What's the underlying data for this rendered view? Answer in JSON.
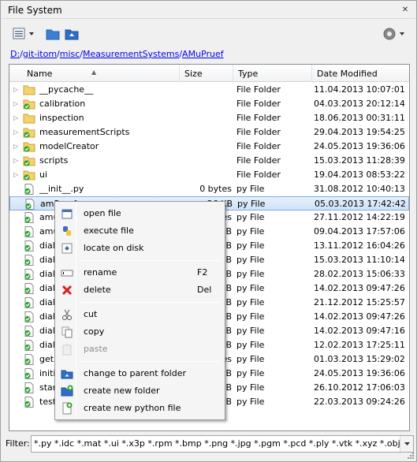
{
  "window": {
    "title": "File System"
  },
  "toolbar": {
    "view_icon": "view-list-icon",
    "folder_icon": "folder-icon",
    "parent_icon": "parent-folder-icon",
    "settings_icon": "gear-icon"
  },
  "path": {
    "segments": [
      "D:",
      "git-itom",
      "misc",
      "MeasurementSystems",
      "AMuPruef"
    ],
    "separator": "/"
  },
  "columns": {
    "name": "Name",
    "size": "Size",
    "type": "Type",
    "date": "Date Modified"
  },
  "files": [
    {
      "name": "__pycache__",
      "size": "",
      "type": "File Folder",
      "date": "11.04.2013 10:07:01",
      "kind": "folder",
      "expandable": true
    },
    {
      "name": "calibration",
      "size": "",
      "type": "File Folder",
      "date": "04.03.2013 20:12:14",
      "kind": "folder-check",
      "expandable": true
    },
    {
      "name": "inspection",
      "size": "",
      "type": "File Folder",
      "date": "18.06.2013 00:31:11",
      "kind": "folder",
      "expandable": true
    },
    {
      "name": "measurementScripts",
      "size": "",
      "type": "File Folder",
      "date": "29.04.2013 19:54:25",
      "kind": "folder-check",
      "expandable": true
    },
    {
      "name": "modelCreator",
      "size": "",
      "type": "File Folder",
      "date": "24.05.2013 19:36:06",
      "kind": "folder-check",
      "expandable": true
    },
    {
      "name": "scripts",
      "size": "",
      "type": "File Folder",
      "date": "15.03.2013 11:28:39",
      "kind": "folder-check",
      "expandable": true
    },
    {
      "name": "ui",
      "size": "",
      "type": "File Folder",
      "date": "19.04.2013 08:53:22",
      "kind": "folder-check",
      "expandable": true
    },
    {
      "name": "__init__.py",
      "size": "0 bytes",
      "type": "py File",
      "date": "31.08.2012 10:40:13",
      "kind": "py",
      "expandable": false
    },
    {
      "name": "amPruef.py",
      "size": "26 KB",
      "type": "py File",
      "date": "05.03.2013 17:42:42",
      "kind": "py",
      "expandable": false,
      "selected": true
    },
    {
      "name": "amu",
      "size": "es",
      "type": "py File",
      "date": "27.11.2012 14:22:19",
      "kind": "py",
      "expandable": false
    },
    {
      "name": "amu",
      "size": "B",
      "type": "py File",
      "date": "09.04.2013 17:57:06",
      "kind": "py",
      "expandable": false
    },
    {
      "name": "dial",
      "size": "B",
      "type": "py File",
      "date": "13.11.2012 16:04:26",
      "kind": "py",
      "expandable": false
    },
    {
      "name": "dial",
      "size": "B",
      "type": "py File",
      "date": "15.03.2013 11:10:14",
      "kind": "py",
      "expandable": false
    },
    {
      "name": "dial",
      "size": "B",
      "type": "py File",
      "date": "28.02.2013 15:06:33",
      "kind": "py",
      "expandable": false
    },
    {
      "name": "dial",
      "size": "B",
      "type": "py File",
      "date": "14.02.2013 09:47:26",
      "kind": "py",
      "expandable": false
    },
    {
      "name": "dial",
      "size": "B",
      "type": "py File",
      "date": "21.12.2012 15:25:57",
      "kind": "py",
      "expandable": false
    },
    {
      "name": "dial",
      "size": "B",
      "type": "py File",
      "date": "14.02.2013 09:47:26",
      "kind": "py",
      "expandable": false
    },
    {
      "name": "dial",
      "size": "B",
      "type": "py File",
      "date": "14.02.2013 09:47:16",
      "kind": "py",
      "expandable": false
    },
    {
      "name": "dial",
      "size": "B",
      "type": "py File",
      "date": "12.02.2013 17:25:11",
      "kind": "py",
      "expandable": false
    },
    {
      "name": "getl",
      "size": "es",
      "type": "py File",
      "date": "01.03.2013 15:29:02",
      "kind": "py",
      "expandable": false
    },
    {
      "name": "initi",
      "size": "B",
      "type": "py File",
      "date": "24.05.2013 19:36:06",
      "kind": "py",
      "expandable": false
    },
    {
      "name": "star",
      "size": "B",
      "type": "py File",
      "date": "26.10.2012 17:06:03",
      "kind": "py",
      "expandable": false
    },
    {
      "name": "test",
      "size": "B",
      "type": "py File",
      "date": "22.03.2013 09:24:26",
      "kind": "py",
      "expandable": false
    }
  ],
  "filter": {
    "label": "Filter:",
    "value": "*.py *.idc *.mat *.ui *.x3p *.rpm *.bmp *.png *.jpg *.pgm *.pcd *.ply *.vtk *.xyz *.obj *.stl)"
  },
  "context_menu": {
    "groups": [
      [
        {
          "label": "open file",
          "icon": "open-file-icon",
          "enabled": true
        },
        {
          "label": "execute file",
          "icon": "python-icon",
          "enabled": true
        },
        {
          "label": "locate on disk",
          "icon": "locate-icon",
          "enabled": true
        }
      ],
      [
        {
          "label": "rename",
          "shortcut": "F2",
          "icon": "rename-icon",
          "enabled": true
        },
        {
          "label": "delete",
          "shortcut": "Del",
          "icon": "delete-icon",
          "enabled": true
        }
      ],
      [
        {
          "label": "cut",
          "icon": "scissors-icon",
          "enabled": true
        },
        {
          "label": "copy",
          "icon": "copy-icon",
          "enabled": true
        },
        {
          "label": "paste",
          "icon": "paste-icon",
          "enabled": false
        }
      ],
      [
        {
          "label": "change to parent folder",
          "icon": "parent-folder-icon",
          "enabled": true
        },
        {
          "label": "create new folder",
          "icon": "new-folder-icon",
          "enabled": true
        },
        {
          "label": "create new python file",
          "icon": "new-python-file-icon",
          "enabled": true
        }
      ]
    ]
  }
}
